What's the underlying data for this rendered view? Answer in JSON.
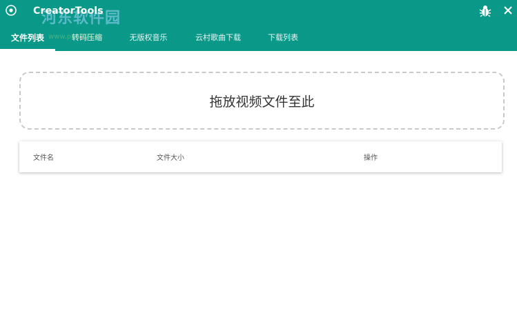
{
  "window": {
    "title": "CreatorTools",
    "watermark": "河东软件园",
    "watermark_url": "www.pc0359.cn"
  },
  "header": {
    "background": "#0a9888",
    "icons": [
      "app-logo-icon",
      "bug-icon",
      "close-icon"
    ]
  },
  "tabs": [
    {
      "label": "文件列表",
      "active": true
    },
    {
      "label": "转码压缩",
      "active": false
    },
    {
      "label": "无版权音乐",
      "active": false
    },
    {
      "label": "云村歌曲下载",
      "active": false
    },
    {
      "label": "下载列表",
      "active": false
    }
  ],
  "dropzone": {
    "label": "拖放视频文件至此"
  },
  "table": {
    "columns": [
      "文件名",
      "文件大小",
      "操作"
    ],
    "rows": []
  }
}
